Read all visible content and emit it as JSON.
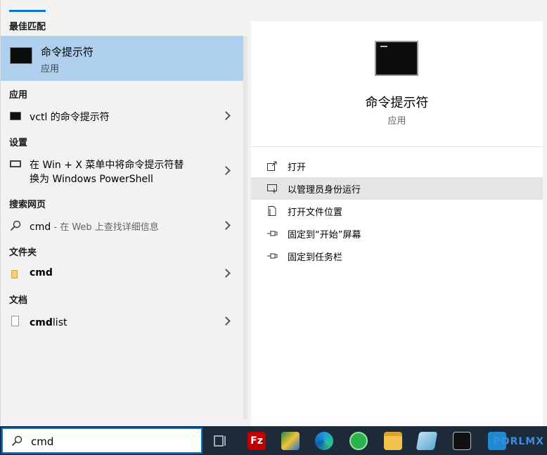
{
  "left": {
    "best_match_header": "最佳匹配",
    "best_match": {
      "title": "命令提示符",
      "subtitle": "应用"
    },
    "apps_header": "应用",
    "apps": [
      {
        "label": "vctl 的命令提示符"
      }
    ],
    "settings_header": "设置",
    "settings": [
      {
        "line1": "在 Win + X 菜单中将命令提示符替",
        "line2": "换为 Windows PowerShell"
      }
    ],
    "web_header": "搜索网页",
    "web": {
      "query": "cmd",
      "hint": " - 在 Web 上查找详细信息"
    },
    "folders_header": "文件夹",
    "folders": [
      {
        "label": "cmd"
      }
    ],
    "docs_header": "文档",
    "docs": [
      {
        "bold": "cmd",
        "rest": "list"
      }
    ]
  },
  "right": {
    "title": "命令提示符",
    "subtitle": "应用",
    "actions": [
      {
        "label": "打开",
        "icon": "open-icon"
      },
      {
        "label": "以管理员身份运行",
        "icon": "shield-icon"
      },
      {
        "label": "打开文件位置",
        "icon": "file-location-icon"
      },
      {
        "label": "固定到“开始”屏幕",
        "icon": "pin-icon"
      },
      {
        "label": "固定到任务栏",
        "icon": "pin-icon"
      }
    ]
  },
  "taskbar": {
    "search_value": "cmd",
    "watermark": "PORLMX",
    "icons": [
      "task-view-icon",
      "filezilla-icon",
      "idm-icon",
      "edge-icon",
      "wechat-icon",
      "file-explorer-icon",
      "notepad-icon",
      "terminal-icon",
      "vscode-icon"
    ]
  },
  "colors": {
    "accent": "#0078d7",
    "selected": "#aed0ee",
    "taskbar": "#1c2a3a"
  }
}
